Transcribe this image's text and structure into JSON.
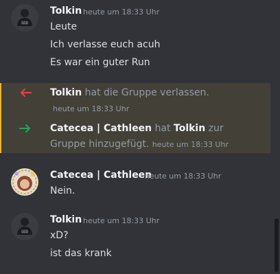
{
  "messages": [
    {
      "author": "Tolkin",
      "timestamp": "heute um 18:33 Uhr",
      "lines": [
        "Leute",
        "Ich verlasse euch acuh",
        "Es war ein guter Run"
      ]
    },
    {
      "author": "Catecea | Cathleen",
      "timestamp": "heute um 18:33 Uhr",
      "lines": [
        "Nein."
      ]
    },
    {
      "author": "Tolkin",
      "timestamp": "heute um 18:33 Uhr",
      "lines": [
        "xD?",
        "ist das krank"
      ]
    }
  ],
  "system_events": [
    {
      "type": "leave",
      "icon": "arrow-left-icon",
      "color": "#f23f43",
      "actor": "Tolkin",
      "text": "hat die Gruppe verlassen.",
      "timestamp": "heute um 18:33 Uhr"
    },
    {
      "type": "add",
      "icon": "arrow-right-icon",
      "color": "#23a55a",
      "actor": "Catecea | Cathleen",
      "middle": "hat",
      "target": "Tolkin",
      "text_line1_end": "zur",
      "text_line2": "Gruppe hinzugefügt.",
      "timestamp": "heute um 18:33 Uhr"
    }
  ],
  "colors": {
    "background": "#323339",
    "highlight_bg": "#434038",
    "highlight_border": "#f0b232"
  }
}
